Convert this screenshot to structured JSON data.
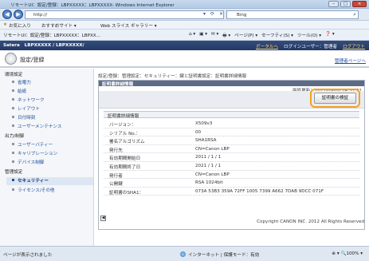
{
  "window": {
    "title": "リモートUI：設定/登録：LBPXXXXX：LBPXXXXX- Windows Internet Explorer",
    "minimize": "–",
    "maximize": "□",
    "close": "×"
  },
  "browser": {
    "back": "◀",
    "forward": "▶",
    "url": "http://",
    "search_placeholder": "Bing",
    "favorites_label": "お気に入り",
    "fav_items": [
      "おすすめサイト ▾",
      "Web スライス ギャラリー ▾"
    ],
    "tab_title": "リモートUI：設定/登録：LBPXXXXX：LBPXX...",
    "cmd_items": [
      "⌂ ▾",
      "▣ ▾",
      "✉ ▾",
      "🖶 ▾",
      "ページ(P) ▾",
      "セーフティ(S) ▾",
      "ツール(O) ▾",
      "❓ ▾"
    ]
  },
  "app": {
    "brand": "Satera",
    "device": "LBPXXXXX / LBPXXXXX/",
    "links": [
      "ポータルへ",
      "ログインユーザー：管理者",
      "ログアウト"
    ],
    "page_title": "設定/登録",
    "portal_link": "管理者ページへ"
  },
  "sidebar": {
    "groups": [
      {
        "label": "環境設定",
        "items": [
          "省電力",
          "給紙",
          "ネットワーク",
          "レイアウト",
          "日付時刻",
          "ユーザーメンテナンス"
        ]
      },
      {
        "label": "出力/制御",
        "items": [
          "ユーザーバティー",
          "キャリブレーション",
          "デバイス制御"
        ]
      },
      {
        "label": "管理設定",
        "items": [
          "セキュリティー",
          "ライセンス/その他"
        ]
      }
    ]
  },
  "main": {
    "breadcrumb": "設定/登録：管理設定：セキュリティー：鍵と証明書設定：証明書詳細情報",
    "panel_title": "証明書詳細情報",
    "updated": "最終更新：2011/09/08 14:37:21",
    "verify_button": "証明書の検証",
    "detail_title": "証明書詳細情報",
    "rows": [
      {
        "k": "バージョン：",
        "v": "X509v3"
      },
      {
        "k": "シリアル No.：",
        "v": "00"
      },
      {
        "k": "署名アルゴリズム",
        "v": "SHA1RSA"
      },
      {
        "k": "発行先",
        "v": "CN=Canon LBP"
      },
      {
        "k": "有効期間開始日",
        "v": "2011 / 1 / 1"
      },
      {
        "k": "有効期間終了日",
        "v": "2021 / 1 / 1"
      },
      {
        "k": "発行者",
        "v": "CN=Canon LBP"
      },
      {
        "k": "公開鍵",
        "v": "RSA 1024bit"
      },
      {
        "k": "証明書のSHA1：",
        "v": "073A 53B3 359A 72FF 1005 7399 A662 7DAB 9DCC 071F"
      }
    ],
    "back_icon": "◀",
    "copyright": "Copyright CANON INC. 2012 All Rights Reserved"
  },
  "statusbar": {
    "left": "ページが表示されました",
    "zone": "インターネット | 保護モード：有効",
    "zoom": "⊕ ▾  🔍100%  ▾"
  }
}
